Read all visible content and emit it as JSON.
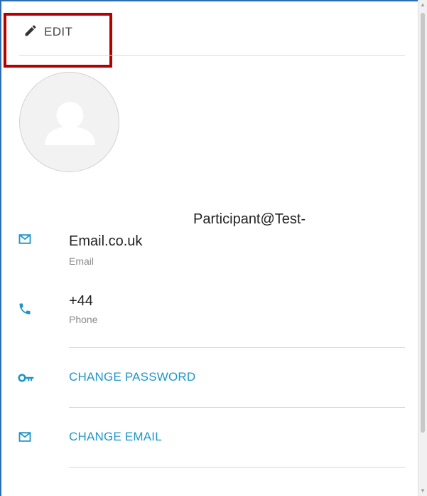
{
  "toolbar": {
    "edit_label": "EDIT"
  },
  "profile": {
    "email_line1": "Participant@Test-",
    "email_line2": "Email.co.uk",
    "email_caption": "Email",
    "phone_value": "+44",
    "phone_caption": "Phone"
  },
  "actions": {
    "change_password": "CHANGE PASSWORD",
    "change_email": "CHANGE EMAIL"
  },
  "colors": {
    "accent": "#1e96c8",
    "highlight_box": "#b40000",
    "frame": "#2f6db3"
  },
  "icons": {
    "edit": "pencil-icon",
    "email": "mail-icon",
    "phone": "phone-icon",
    "password": "key-icon",
    "change_email": "mail-icon"
  }
}
